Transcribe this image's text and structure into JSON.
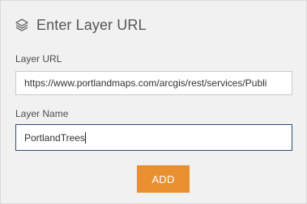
{
  "dialog": {
    "icon": "layers-icon",
    "title": "Enter Layer URL"
  },
  "layer_url": {
    "label": "Layer URL",
    "value": "https://www.portlandmaps.com/arcgis/rest/services/Publi"
  },
  "layer_name": {
    "label": "Layer Name",
    "value": "PortlandTrees"
  },
  "actions": {
    "add_label": "ADD",
    "add_color": "#e8902f"
  }
}
